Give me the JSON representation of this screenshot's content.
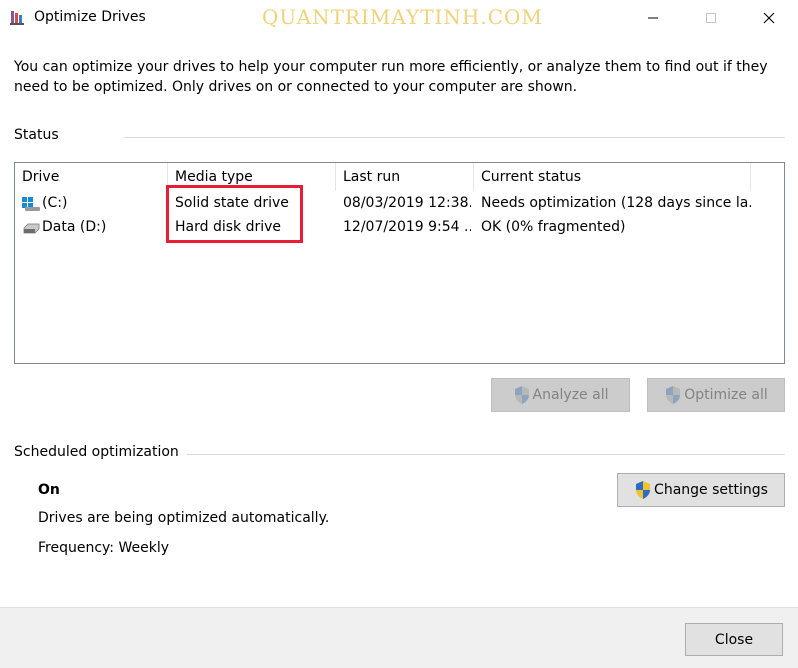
{
  "window": {
    "title": "Optimize Drives",
    "watermark": "QUANTRIMAYTINH.COM",
    "icon": "optimize-drives-app-icon"
  },
  "intro_text": "You can optimize your drives to help your computer run more efficiently, or analyze them to find out if they need to be optimized. Only drives on or connected to your computer are shown.",
  "status": {
    "label": "Status",
    "columns": [
      "Drive",
      "Media type",
      "Last run",
      "Current status"
    ],
    "rows": [
      {
        "drive": "(C:)",
        "media_type": "Solid state drive",
        "last_run": "08/03/2019 12:38...",
        "current_status": "Needs optimization (128 days since la...",
        "icon": "windows-drive-icon"
      },
      {
        "drive": "Data (D:)",
        "media_type": "Hard disk drive",
        "last_run": "12/07/2019 9:54 ...",
        "current_status": "OK (0% fragmented)",
        "icon": "hard-drive-icon"
      }
    ],
    "analyze_label": "Analyze all",
    "optimize_label": "Optimize all"
  },
  "scheduled": {
    "label": "Scheduled optimization",
    "state": "On",
    "description": "Drives are being optimized automatically.",
    "frequency": "Frequency: Weekly",
    "change_settings_label": "Change settings"
  },
  "footer": {
    "close_label": "Close"
  },
  "colors": {
    "highlight": "#e81c34",
    "watermark": "#f0d27a",
    "shield_blue": "#2b6cc4",
    "shield_yellow": "#f2c12e"
  }
}
